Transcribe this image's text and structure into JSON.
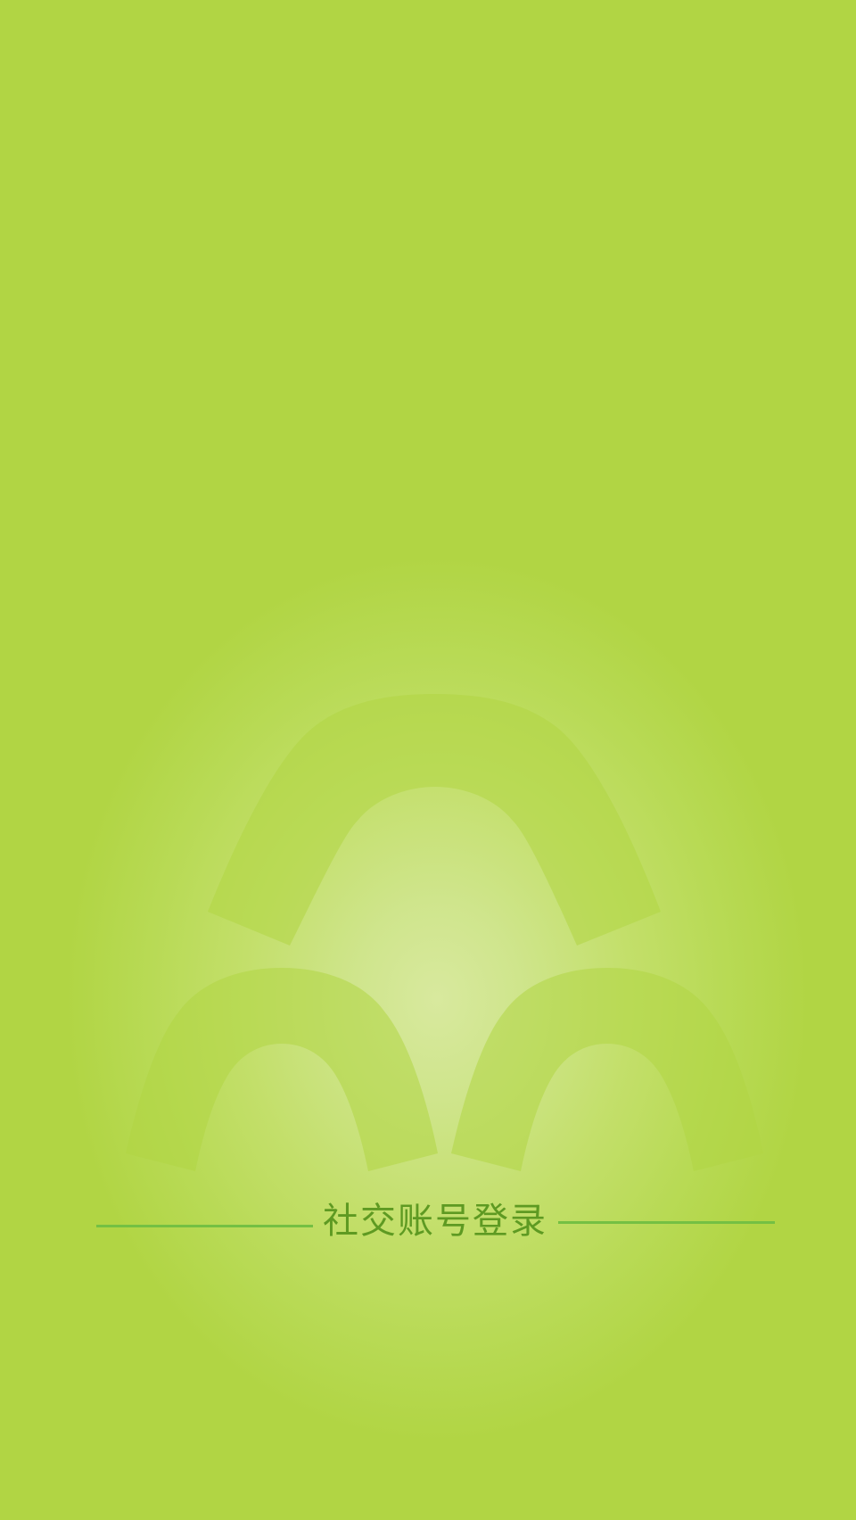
{
  "login": {
    "social_title": "社交账号登录"
  },
  "colors": {
    "background": "#b1d544",
    "accent_line": "#74c043",
    "title_text": "#5e9a22"
  },
  "icons": {
    "emblem": "three-arches-logo-icon"
  }
}
